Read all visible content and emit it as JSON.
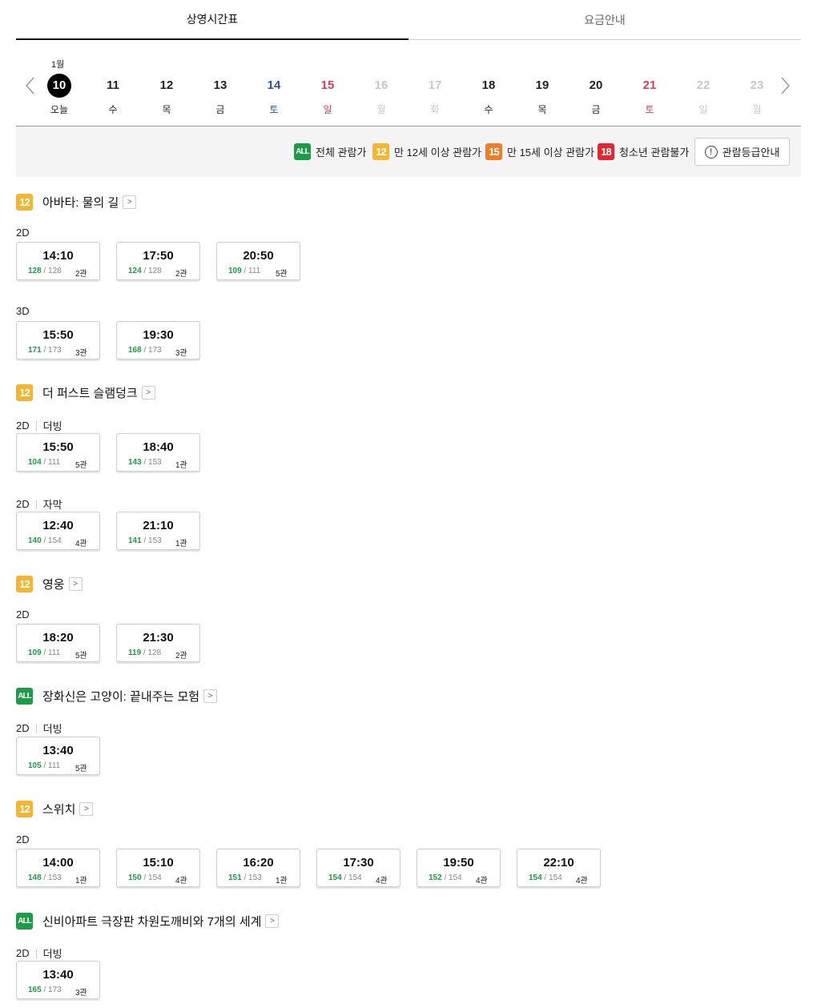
{
  "tabs": [
    {
      "label": "상영시간표"
    },
    {
      "label": "요금안내"
    }
  ],
  "calendar": {
    "month": "1월",
    "days": [
      {
        "num": "10",
        "wd": "오늘"
      },
      {
        "num": "11",
        "wd": "수"
      },
      {
        "num": "12",
        "wd": "목"
      },
      {
        "num": "13",
        "wd": "금"
      },
      {
        "num": "14",
        "wd": "토"
      },
      {
        "num": "15",
        "wd": "일"
      },
      {
        "num": "16",
        "wd": "월"
      },
      {
        "num": "17",
        "wd": "화"
      },
      {
        "num": "18",
        "wd": "수"
      },
      {
        "num": "19",
        "wd": "목"
      },
      {
        "num": "20",
        "wd": "금"
      },
      {
        "num": "21",
        "wd": "토"
      },
      {
        "num": "22",
        "wd": "일"
      },
      {
        "num": "23",
        "wd": "월"
      }
    ]
  },
  "legend": {
    "all": {
      "badge": "ALL",
      "label": "전체 관람가"
    },
    "r12": {
      "badge": "12",
      "label": "만 12세 이상 관람가"
    },
    "r15": {
      "badge": "15",
      "label": "만 15세 이상 관람가"
    },
    "r18": {
      "badge": "18",
      "label": "청소년 관람불가"
    },
    "guide_button": "관람등급안내"
  },
  "movies": [
    {
      "rating": "12",
      "title": "아바타: 물의 길",
      "groups": [
        {
          "format": "2D",
          "sub": "",
          "slots": [
            {
              "time": "14:10",
              "rem": "128",
              "total": "128",
              "hall": "2관"
            },
            {
              "time": "17:50",
              "rem": "124",
              "total": "128",
              "hall": "2관"
            },
            {
              "time": "20:50",
              "rem": "109",
              "total": "111",
              "hall": "5관"
            }
          ]
        },
        {
          "format": "3D",
          "sub": "",
          "slots": [
            {
              "time": "15:50",
              "rem": "171",
              "total": "173",
              "hall": "3관"
            },
            {
              "time": "19:30",
              "rem": "168",
              "total": "173",
              "hall": "3관"
            }
          ]
        }
      ]
    },
    {
      "rating": "12",
      "title": "더 퍼스트 슬램덩크",
      "groups": [
        {
          "format": "2D",
          "sub": "더빙",
          "slots": [
            {
              "time": "15:50",
              "rem": "104",
              "total": "111",
              "hall": "5관"
            },
            {
              "time": "18:40",
              "rem": "143",
              "total": "153",
              "hall": "1관"
            }
          ]
        },
        {
          "format": "2D",
          "sub": "자막",
          "slots": [
            {
              "time": "12:40",
              "rem": "140",
              "total": "154",
              "hall": "4관"
            },
            {
              "time": "21:10",
              "rem": "141",
              "total": "153",
              "hall": "1관"
            }
          ]
        }
      ]
    },
    {
      "rating": "12",
      "title": "영웅",
      "groups": [
        {
          "format": "2D",
          "sub": "",
          "slots": [
            {
              "time": "18:20",
              "rem": "109",
              "total": "111",
              "hall": "5관"
            },
            {
              "time": "21:30",
              "rem": "119",
              "total": "128",
              "hall": "2관"
            }
          ]
        }
      ]
    },
    {
      "rating": "ALL",
      "title": "장화신은 고양이: 끝내주는 모험",
      "groups": [
        {
          "format": "2D",
          "sub": "더빙",
          "slots": [
            {
              "time": "13:40",
              "rem": "105",
              "total": "111",
              "hall": "5관"
            }
          ]
        }
      ]
    },
    {
      "rating": "12",
      "title": "스위치",
      "groups": [
        {
          "format": "2D",
          "sub": "",
          "slots": [
            {
              "time": "14:00",
              "rem": "148",
              "total": "153",
              "hall": "1관"
            },
            {
              "time": "15:10",
              "rem": "150",
              "total": "154",
              "hall": "4관"
            },
            {
              "time": "16:20",
              "rem": "151",
              "total": "153",
              "hall": "1관"
            },
            {
              "time": "17:30",
              "rem": "154",
              "total": "154",
              "hall": "4관"
            },
            {
              "time": "19:50",
              "rem": "152",
              "total": "154",
              "hall": "4관"
            },
            {
              "time": "22:10",
              "rem": "154",
              "total": "154",
              "hall": "4관"
            }
          ]
        }
      ]
    },
    {
      "rating": "ALL",
      "title": "신비아파트 극장판 차원도깨비와 7개의 세계",
      "groups": [
        {
          "format": "2D",
          "sub": "더빙",
          "slots": [
            {
              "time": "13:40",
              "rem": "165",
              "total": "173",
              "hall": "3관"
            }
          ]
        }
      ]
    }
  ]
}
